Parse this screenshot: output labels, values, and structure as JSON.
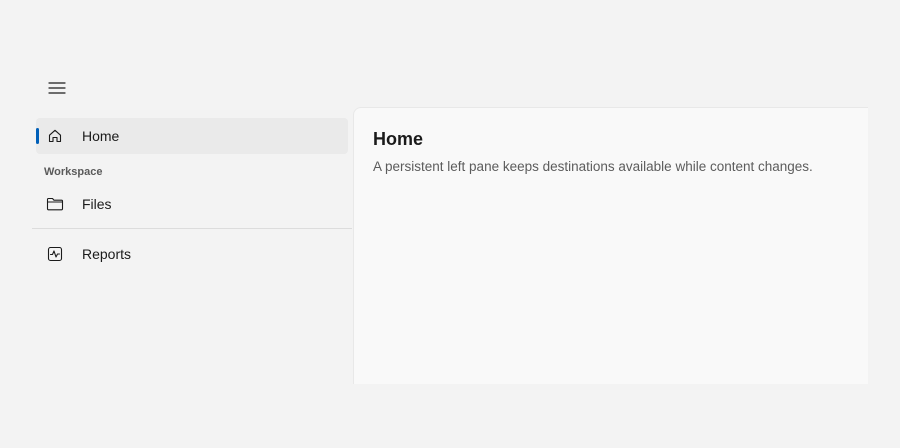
{
  "nav": {
    "items": [
      {
        "label": "Home",
        "icon": "home-icon",
        "selected": true
      },
      {
        "label": "Files",
        "icon": "folder-icon",
        "selected": false
      },
      {
        "label": "Reports",
        "icon": "chart-icon",
        "selected": false
      }
    ],
    "section_header": "Workspace"
  },
  "content": {
    "title": "Home",
    "description": "A persistent left pane keeps destinations available while content changes."
  },
  "colors": {
    "accent": "#005fb8",
    "selected_background": "#eaeaea",
    "page_background": "#f3f3f3",
    "content_background": "#f9f9f9"
  }
}
